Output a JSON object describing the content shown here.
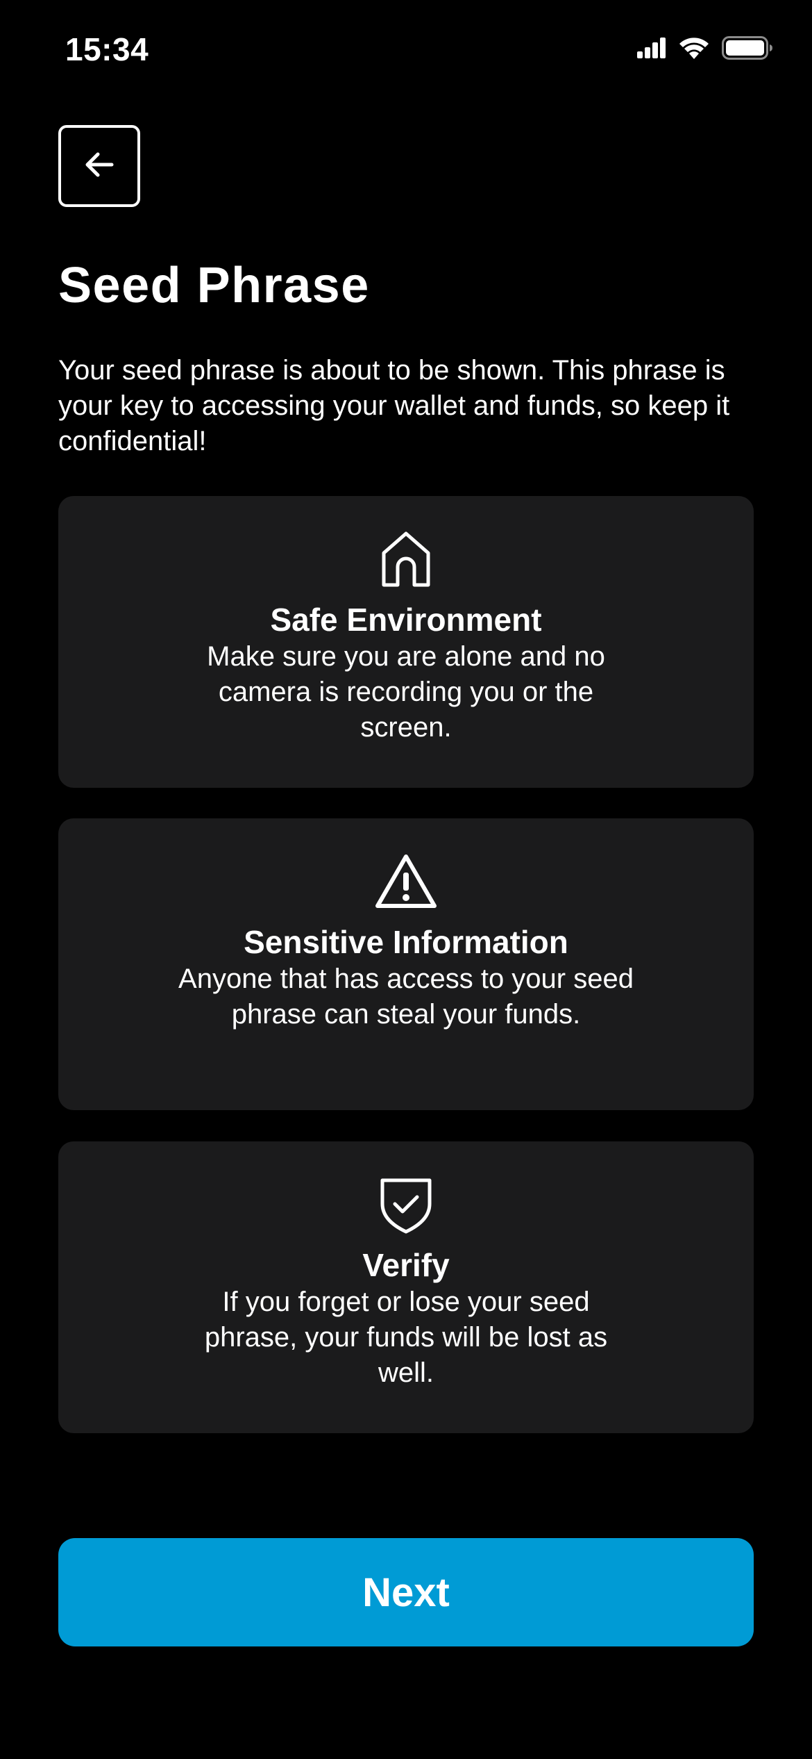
{
  "status_bar": {
    "time": "15:34",
    "icons": [
      "cellular-signal-icon",
      "wifi-icon",
      "battery-icon"
    ]
  },
  "header": {
    "back_icon": "arrow-left-icon",
    "title": "Seed Phrase"
  },
  "intro": "Your seed phrase is about to be shown. This phrase is your key to accessing your wallet and funds, so keep it confidential!",
  "cards": [
    {
      "icon": "house-icon",
      "title": "Safe Environment",
      "description": "Make sure you are alone and no camera is recording you or the screen."
    },
    {
      "icon": "warning-triangle-icon",
      "title": "Sensitive Information",
      "description": "Anyone that has access to your seed phrase can steal your funds."
    },
    {
      "icon": "shield-check-icon",
      "title": "Verify",
      "description": "If you forget or lose your seed phrase, your funds will be lost as well."
    }
  ],
  "next_button": {
    "label": "Next"
  },
  "colors": {
    "background": "#000000",
    "card": "#1b1b1c",
    "accent": "#009bd5",
    "text": "#ffffff"
  }
}
